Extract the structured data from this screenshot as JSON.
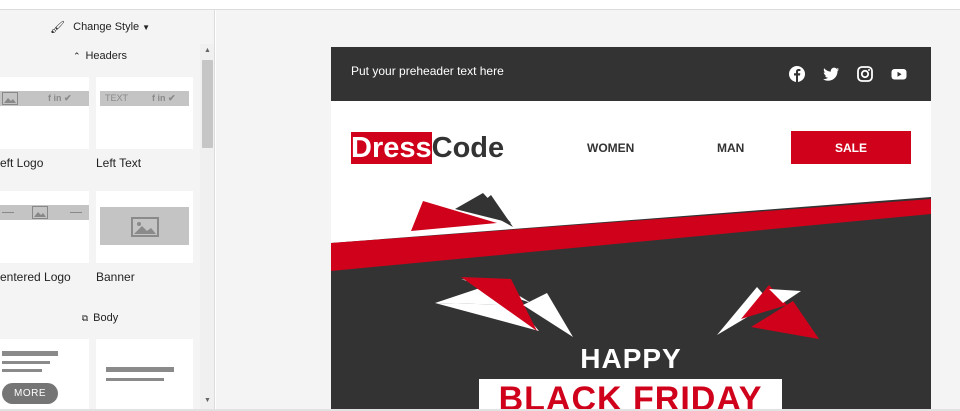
{
  "toolbar": {
    "change_style": "Change Style"
  },
  "sidebar": {
    "headers_title": "Headers",
    "body_title": "Body",
    "tiles": {
      "left_logo": {
        "label": "eft Logo",
        "social_text": "f in ✔"
      },
      "left_text": {
        "label": "Left Text",
        "text_word": "TEXT",
        "social_text": "f in ✔"
      },
      "centered_logo": {
        "label": "entered Logo"
      },
      "banner": {
        "label": "Banner"
      }
    },
    "more_label": "MORE"
  },
  "email": {
    "preheader": "Put your preheader text here",
    "social_icons": [
      "facebook-icon",
      "twitter-icon",
      "instagram-icon",
      "youtube-icon"
    ],
    "brand_part1": "Dress",
    "brand_part2": "Code",
    "nav": {
      "women": "WOMEN",
      "man": "MAN",
      "sale": "SALE"
    },
    "hero_line1": "HAPPY",
    "hero_line2": "BLACK FRIDAY"
  },
  "colors": {
    "accent": "#d0021b",
    "dark": "#333333",
    "panel": "#f4f4f4"
  }
}
